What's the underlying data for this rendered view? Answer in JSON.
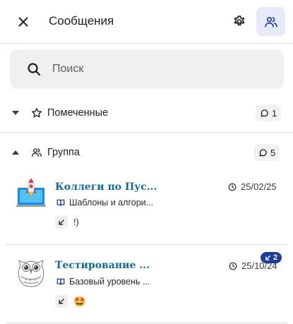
{
  "header": {
    "title": "Сообщения",
    "close_icon": "close-icon",
    "settings_icon": "gear-icon",
    "contacts_icon": "people-icon"
  },
  "search": {
    "placeholder": "Поиск",
    "value": ""
  },
  "sections": {
    "starred": {
      "label": "Помеченные",
      "count": "1",
      "expanded": false
    },
    "group": {
      "label": "Группа",
      "count": "5",
      "expanded": true
    }
  },
  "chats": [
    {
      "title": "Коллеги по Пус...",
      "date": "25/02/25",
      "course": "Шаблоны и алгори...",
      "last_message": "!)",
      "unread": "",
      "avatar": "rocket-avatar"
    },
    {
      "title": "Тестирование ...",
      "date": "25/10/24",
      "course": "Базовый уровень ...",
      "last_message": "🤩",
      "unread": "2",
      "avatar": "owl-avatar"
    }
  ],
  "colors": {
    "accent": "#176a97",
    "badge": "#1e3c9e",
    "active_button_bg": "#e6e9f7"
  }
}
